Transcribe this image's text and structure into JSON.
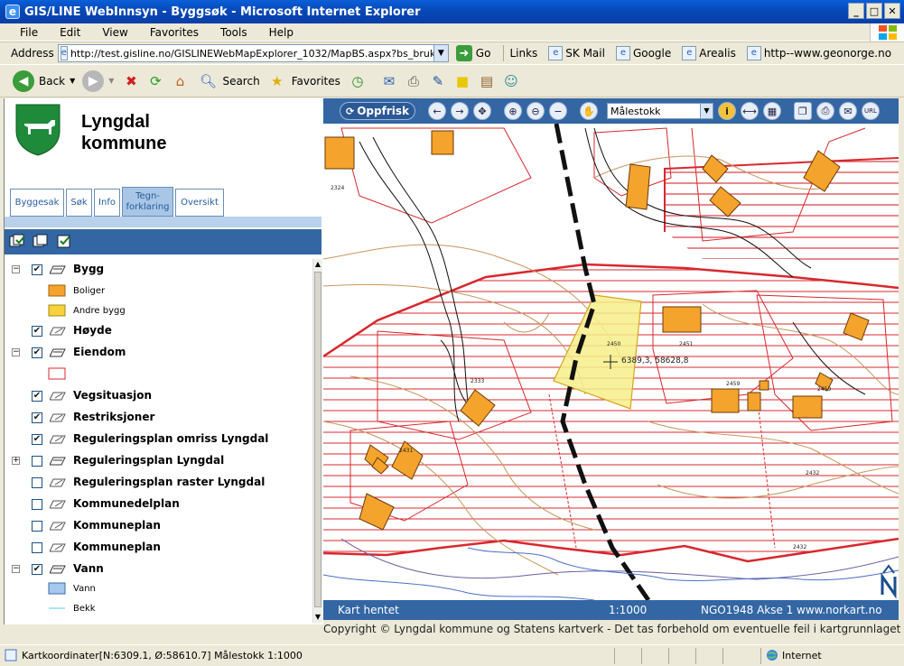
{
  "window": {
    "title": "GIS/LINE WebInnsyn - Byggsøk - Microsoft Internet Explorer"
  },
  "menu": [
    "File",
    "Edit",
    "View",
    "Favorites",
    "Tools",
    "Help"
  ],
  "address": {
    "label": "Address",
    "url": "http://test.gisline.no/GISLINEWebMapExplorer_1032/MapBS.aspx?bs_bruker=ad&",
    "go": "Go"
  },
  "links": {
    "label": "Links",
    "items": [
      "SK Mail",
      "Google",
      "Arealis",
      "http--www.geonorge.no"
    ]
  },
  "toolbar": {
    "back": "Back",
    "search": "Search",
    "favorites": "Favorites"
  },
  "app": {
    "kommune_line1": "Lyngdal",
    "kommune_line2": "kommune",
    "tabs": [
      {
        "label": "Byggesak"
      },
      {
        "label": "Søk"
      },
      {
        "label": "Info"
      },
      {
        "label": "Tegn-\nforklaring",
        "active": true
      },
      {
        "label": "Oversikt"
      }
    ]
  },
  "legend": {
    "layers": [
      {
        "name": "Bygg",
        "expanded": true,
        "checked": true
      },
      {
        "name": "Høyde",
        "checked": true
      },
      {
        "name": "Eiendom",
        "expanded": true,
        "checked": true
      },
      {
        "name": "Vegsituasjon",
        "checked": true
      },
      {
        "name": "Restriksjoner",
        "checked": true
      },
      {
        "name": "Reguleringsplan omriss Lyngdal",
        "checked": true
      },
      {
        "name": "Reguleringsplan Lyngdal",
        "expanded": false,
        "checked": false
      },
      {
        "name": "Reguleringsplan raster Lyngdal",
        "checked": false
      },
      {
        "name": "Kommunedelplan",
        "checked": false
      },
      {
        "name": "Kommuneplan",
        "checked": false
      },
      {
        "name": "Kommuneplan",
        "checked": false
      },
      {
        "name": "Vann",
        "expanded": true,
        "checked": true
      }
    ],
    "symbols": {
      "boliger": "Boliger",
      "andre_bygg": "Andre bygg",
      "vann": "Vann",
      "bekk": "Bekk"
    },
    "colors": {
      "boliger": "#f4a32c",
      "andre_bygg": "#f7d23b",
      "eiendom": "#d8282e",
      "vann": "#a6c8ee",
      "bekk": "#5ac8f0"
    }
  },
  "map": {
    "oppfrisk": "Oppfrisk",
    "scale_select": "Målestokk",
    "coord_label": "6389,3, 58628,8",
    "parcel_numbers": [
      "2324",
      "2450",
      "2451",
      "2333",
      "2459",
      "2432",
      "2432",
      "2431",
      "2459"
    ],
    "status_left": "Kart hentet",
    "status_scale": "1:1000",
    "status_proj": "NGO1948 Akse 1",
    "status_site": "www.norkart.no",
    "copyright": "Copyright © Lyngdal kommune og Statens kartverk - Det tas forbehold om eventuelle feil i kartgrunnlaget"
  },
  "statusbar": {
    "text": "Kartkoordinater[N:6309.1, Ø:58610.7] Målestokk 1:1000",
    "zone": "Internet"
  }
}
